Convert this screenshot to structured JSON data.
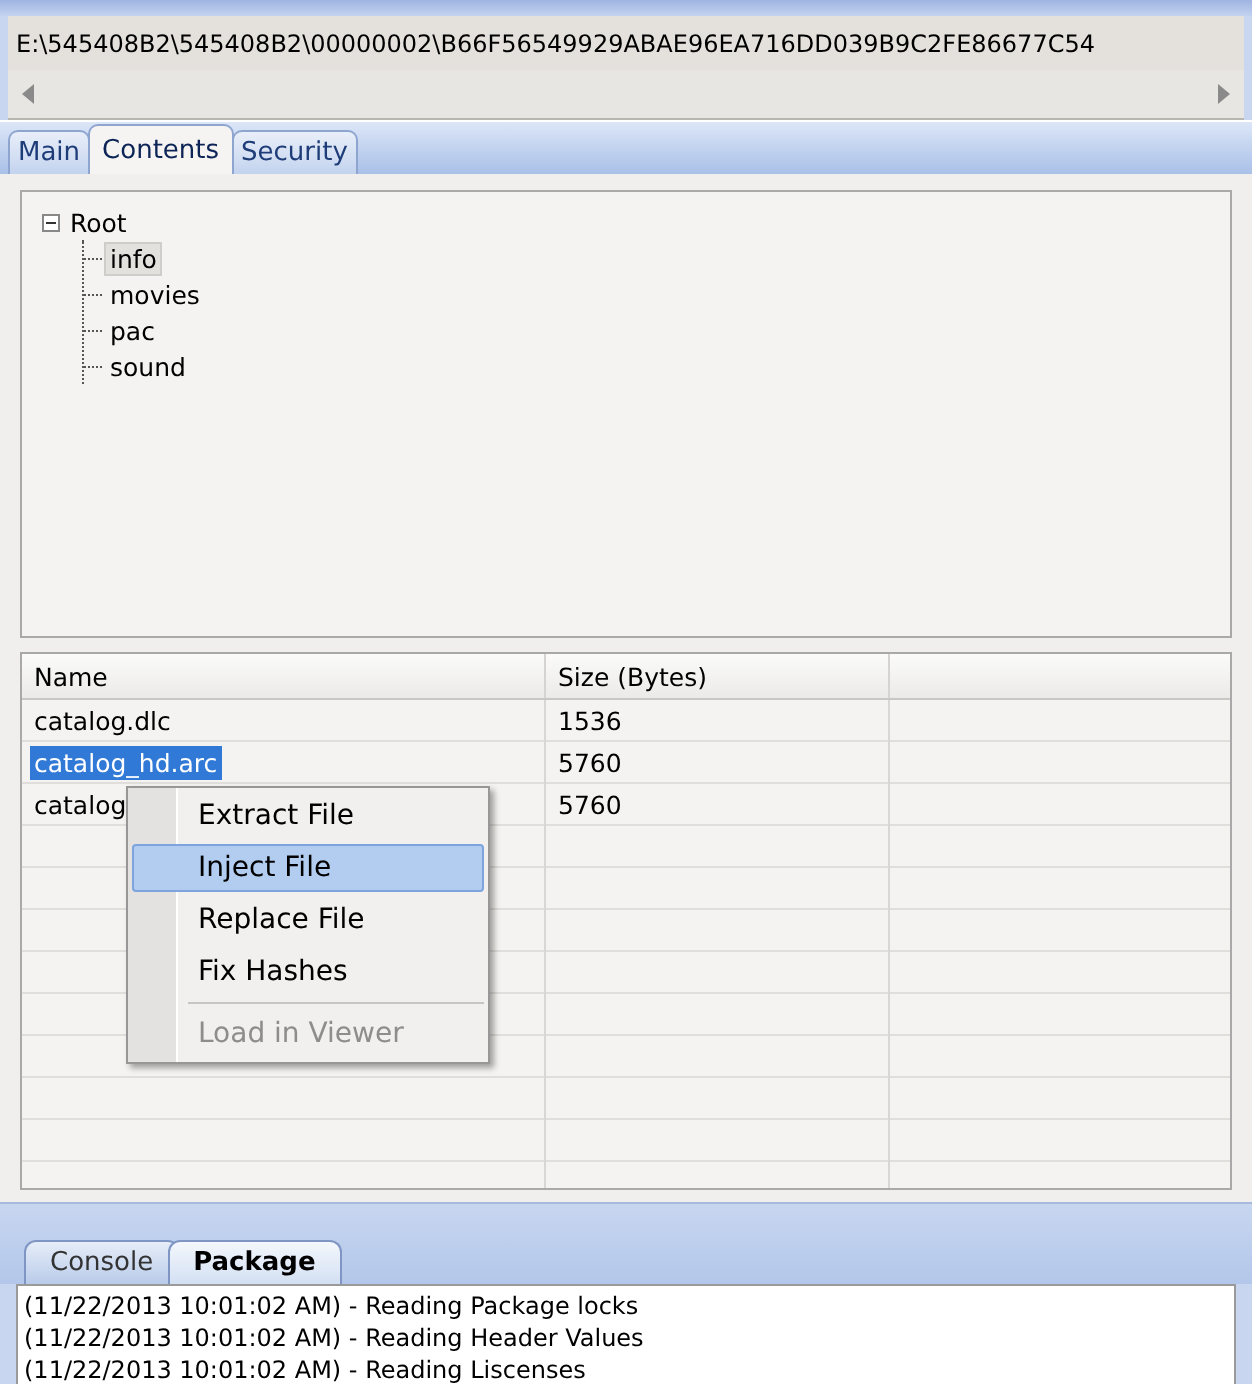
{
  "path_bar": {
    "value": "E:\\545408B2\\545408B2\\00000002\\B66F56549929ABAE96EA716DD039B9C2FE86677C54"
  },
  "tabs": [
    {
      "label": "Main",
      "selected": false
    },
    {
      "label": "Contents",
      "selected": true
    },
    {
      "label": "Security",
      "selected": false
    }
  ],
  "tree": [
    {
      "label": "Root",
      "expanded": true,
      "selected": false,
      "children": [
        {
          "label": "info",
          "selected": true
        },
        {
          "label": "movies",
          "selected": false
        },
        {
          "label": "pac",
          "selected": false
        },
        {
          "label": "sound",
          "selected": false
        }
      ]
    }
  ],
  "table": {
    "columns": [
      "Name",
      "Size (Bytes)"
    ],
    "rows": [
      {
        "name": "catalog.dlc",
        "size": "1536",
        "selected": false
      },
      {
        "name": "catalog_hd.arc",
        "size": "5760",
        "selected": true
      },
      {
        "name": "catalog",
        "size": "5760",
        "selected": false
      }
    ]
  },
  "context_menu": [
    {
      "kind": "item",
      "label": "Extract File",
      "selected": false,
      "disabled": false
    },
    {
      "kind": "item",
      "label": "Inject File",
      "selected": true,
      "disabled": false
    },
    {
      "kind": "item",
      "label": "Replace File",
      "selected": false,
      "disabled": false
    },
    {
      "kind": "item",
      "label": "Fix Hashes",
      "selected": false,
      "disabled": false
    },
    {
      "kind": "separator"
    },
    {
      "kind": "item",
      "label": "Load in Viewer",
      "selected": false,
      "disabled": true
    }
  ],
  "bottom_tabs": [
    {
      "label": "Console",
      "selected": false
    },
    {
      "label": "Package",
      "selected": true
    }
  ],
  "log": [
    "(11/22/2013 10:01:02 AM) - Reading Package locks",
    "(11/22/2013 10:01:02 AM) - Reading Header Values",
    "(11/22/2013 10:01:02 AM) - Reading Liscenses"
  ]
}
